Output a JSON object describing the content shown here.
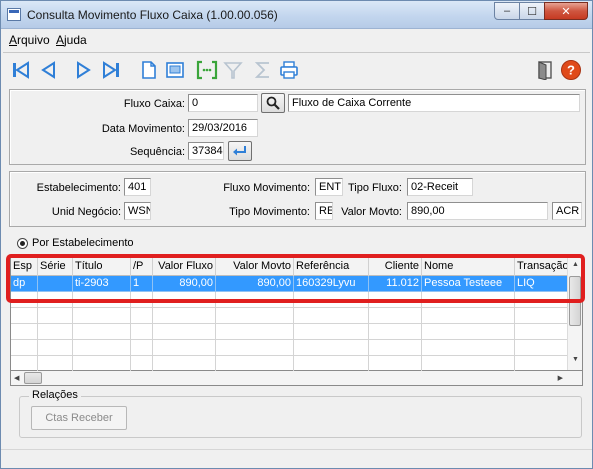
{
  "window": {
    "title": "Consulta Movimento Fluxo Caixa (1.00.00.056)",
    "minimize_glyph": "‒",
    "maximize_glyph": "☐",
    "close_glyph": "✕"
  },
  "menu": {
    "arquivo": {
      "underlined": "A",
      "rest": "rquivo"
    },
    "ajuda": {
      "underlined": "A",
      "rest": "juda"
    }
  },
  "toolbar": {
    "icons": [
      "first-record-icon",
      "previous-record-icon",
      "next-record-icon",
      "last-record-icon",
      "new-document-icon",
      "preview-icon",
      "goto-icon",
      "filter-icon",
      "sum-icon",
      "print-icon",
      "exit-icon",
      "help-icon"
    ],
    "colors": {
      "nav": "#2f7fd7",
      "help": "#e04a1a"
    }
  },
  "header_form": {
    "fluxo_caixa_label": "Fluxo Caixa:",
    "fluxo_caixa_value": "0",
    "fluxo_caixa_desc": "Fluxo de Caixa Corrente",
    "data_movimento_label": "Data Movimento:",
    "data_movimento_value": "29/03/2016",
    "sequencia_label": "Sequência:",
    "sequencia_value": "37384"
  },
  "detail_form": {
    "estabelecimento_label": "Estabelecimento:",
    "estabelecimento_value": "401",
    "fluxo_movimento_label": "Fluxo Movimento:",
    "fluxo_movimento_value": "ENT",
    "tipo_fluxo_label": "Tipo Fluxo:",
    "tipo_fluxo_value": "02-Receit",
    "unid_negocio_label": "Unid Negócio:",
    "unid_negocio_value": "WSN",
    "tipo_movimento_label": "Tipo Movimento:",
    "tipo_movimento_value": "RE",
    "valor_movto_label": "Valor Movto:",
    "valor_movto_value": "890,00",
    "acr_value": "ACR"
  },
  "radio": {
    "label": "Por Estabelecimento",
    "checked": true
  },
  "grid": {
    "headers": [
      "Esp",
      "Série",
      "Título",
      "/P",
      "Valor Fluxo",
      "Valor Movto",
      "Referência",
      "Cliente",
      "Nome",
      "Transação"
    ],
    "rows": [
      [
        "dp",
        "",
        "ti-2903",
        "1",
        "890,00",
        "890,00",
        "160329Lyvu",
        "11.012",
        "Pessoa Testeee",
        "LIQ"
      ]
    ],
    "selection_color": "#3399ff"
  },
  "relacoes": {
    "title": "Relações",
    "ctas_receber": "Ctas Receber"
  },
  "highlight_color": "#e01f1f"
}
